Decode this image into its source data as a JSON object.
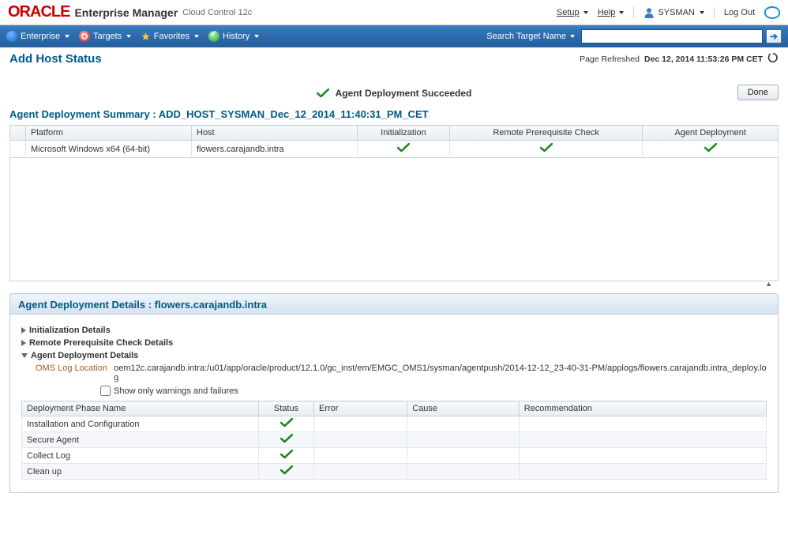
{
  "brand": {
    "logo": "ORACLE",
    "product": "Enterprise Manager",
    "sub": "Cloud Control 12c"
  },
  "top_menu": {
    "setup": "Setup",
    "help": "Help",
    "user": "SYSMAN",
    "logout": "Log Out"
  },
  "nav": {
    "enterprise": "Enterprise",
    "targets": "Targets",
    "favorites": "Favorites",
    "history": "History",
    "search_label": "Search Target Name",
    "search_value": ""
  },
  "page": {
    "title": "Add Host Status",
    "refreshed_label": "Page Refreshed",
    "refreshed_ts": "Dec 12, 2014 11:53:26 PM CET"
  },
  "status": {
    "message": "Agent Deployment Succeeded",
    "done_btn": "Done"
  },
  "summary": {
    "title": "Agent Deployment Summary : ADD_HOST_SYSMAN_Dec_12_2014_11:40:31_PM_CET",
    "cols": {
      "platform": "Platform",
      "host": "Host",
      "init": "Initialization",
      "prereq": "Remote Prerequisite Check",
      "deploy": "Agent Deployment"
    },
    "rows": [
      {
        "platform": "Microsoft Windows x64 (64-bit)",
        "host": "flowers.carajandb.intra"
      }
    ]
  },
  "details": {
    "title": "Agent Deployment Details : flowers.carajandb.intra",
    "sections": {
      "init": "Initialization Details",
      "prereq": "Remote Prerequisite Check Details",
      "deploy": "Agent Deployment Details"
    },
    "log_label": "OMS Log Location",
    "log_value": "oem12c.carajandb.intra:/u01/app/oracle/product/12.1.0/gc_inst/em/EMGC_OMS1/sysman/agentpush/2014-12-12_23-40-31-PM/applogs/flowers.carajandb.intra_deploy.log",
    "filter_label": "Show only warnings and failures",
    "phase_cols": {
      "name": "Deployment Phase Name",
      "status": "Status",
      "error": "Error",
      "cause": "Cause",
      "recommendation": "Recommendation"
    },
    "phases": [
      {
        "name": "Installation and Configuration"
      },
      {
        "name": "Secure Agent"
      },
      {
        "name": "Collect Log"
      },
      {
        "name": "Clean up"
      }
    ]
  }
}
